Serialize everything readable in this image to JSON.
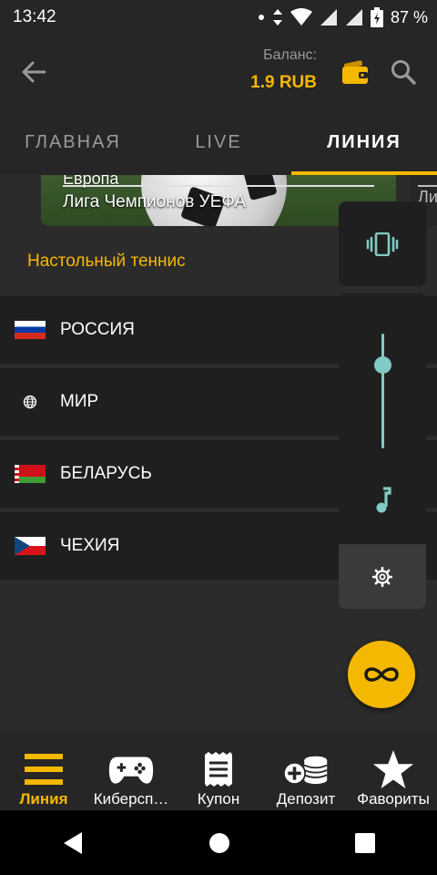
{
  "status_bar": {
    "time": "13:42",
    "battery": "87 %",
    "icons": [
      "dot-icon",
      "data-arrows-icon",
      "wifi-icon",
      "signal-icon",
      "signal-icon",
      "battery-icon"
    ]
  },
  "app_bar": {
    "balance_label": "Баланс:",
    "balance_value": "1.9 RUB"
  },
  "tabs": [
    {
      "label": "ГЛАВНАЯ",
      "active": false
    },
    {
      "label": "LIVE",
      "active": false
    },
    {
      "label": "ЛИНИЯ",
      "active": true
    }
  ],
  "banner": {
    "top_text": "Европа",
    "bottom_text": "Лига Чемпионов УЕФА",
    "next_text": "Ли"
  },
  "section_title": "Настольный теннис",
  "countries": [
    {
      "label": "РОССИЯ",
      "flag": "russia-flag-icon"
    },
    {
      "label": "МИР",
      "flag": "globe-icon"
    },
    {
      "label": "БЕЛАРУСЬ",
      "flag": "belarus-flag-icon"
    },
    {
      "label": "ЧЕХИЯ",
      "flag": "czech-flag-icon"
    }
  ],
  "volume_panel": {
    "level": 0.73,
    "accent_color": "#80cbc4"
  },
  "bottom_nav": [
    {
      "label": "Линия",
      "icon": "menu-lines-icon",
      "active": true
    },
    {
      "label": "Киберсп…",
      "icon": "gamepad-icon",
      "active": false
    },
    {
      "label": "Купон",
      "icon": "coupon-icon",
      "active": false
    },
    {
      "label": "Депозит",
      "icon": "coins-plus-icon",
      "active": false
    },
    {
      "label": "Фавориты",
      "icon": "star-icon",
      "active": false
    }
  ],
  "colors": {
    "accent": "#f5b800",
    "background": "#2b2b2b",
    "surface": "#1f1f1f"
  }
}
